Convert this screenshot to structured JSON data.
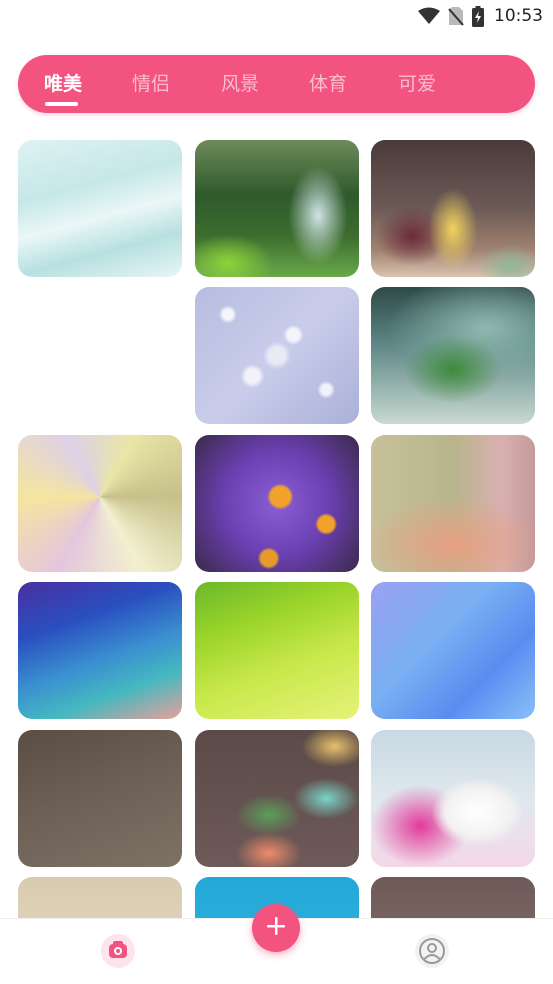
{
  "status_bar": {
    "time": "10:53",
    "icons": [
      "wifi-icon",
      "no-sim-icon",
      "battery-charging-icon"
    ]
  },
  "tabs": [
    {
      "label": "唯美",
      "active": true
    },
    {
      "label": "情侣",
      "active": false
    },
    {
      "label": "风景",
      "active": false
    },
    {
      "label": "体育",
      "active": false
    },
    {
      "label": "可爱",
      "active": false
    }
  ],
  "wallpapers": [
    {
      "name": "soft-teal-abstract"
    },
    {
      "name": "mountain-river-valley"
    },
    {
      "name": "macarons-closeup"
    },
    {
      "name": "blue-bokeh"
    },
    {
      "name": "green-sprout"
    },
    {
      "name": "pastel-geometric"
    },
    {
      "name": "purple-daisies"
    },
    {
      "name": "peach-roses"
    },
    {
      "name": "blue-purple-polygon"
    },
    {
      "name": "lime-green-waves"
    },
    {
      "name": "light-blue-polygon"
    },
    {
      "name": "brown-texture"
    },
    {
      "name": "colorful-macarons"
    },
    {
      "name": "pink-heart-snow"
    },
    {
      "name": "beige-blur"
    },
    {
      "name": "blue-sky"
    },
    {
      "name": "macaron-cup"
    }
  ],
  "bottom_nav": {
    "items": [
      "camera-icon",
      "user-icon"
    ],
    "fab": "plus-icon"
  },
  "colors": {
    "accent": "#f2537f",
    "background": "#ffffff"
  }
}
